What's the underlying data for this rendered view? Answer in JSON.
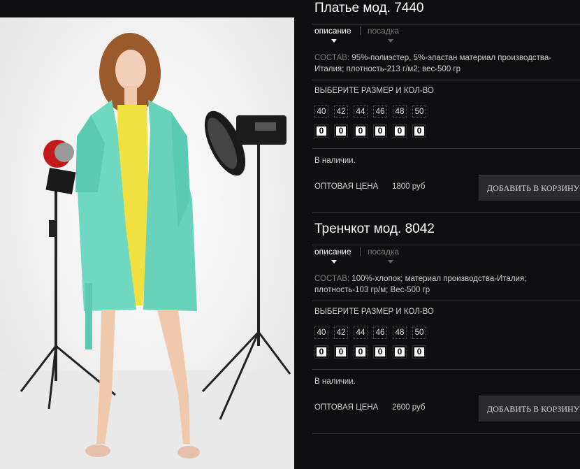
{
  "products": [
    {
      "title": "Платье мод. 7440",
      "tabs": {
        "active": "описание",
        "inactive": "посадка"
      },
      "composition_label": "СОСТАВ:",
      "composition_text": " 95%-полиэстер, 5%-эластан материал производства-Италия; плотность-213 г/м2; вес-500 гр",
      "choose_label": "ВЫБЕРИТЕ РАЗМЕР И КОЛ-ВО",
      "sizes": [
        "40",
        "42",
        "44",
        "46",
        "48",
        "50"
      ],
      "quantities": [
        "0",
        "0",
        "0",
        "0",
        "0",
        "0"
      ],
      "stock": "В наличии.",
      "price_label": "ОПТОВАЯ ЦЕНА",
      "price": "1800 руб",
      "button": "ДОБАВИТЬ В КОРЗИНУ"
    },
    {
      "title": "Тренчкот мод. 8042",
      "tabs": {
        "active": "описание",
        "inactive": "посадка"
      },
      "composition_label": "СОСТАВ:",
      "composition_text": " 100%-хлопок; материал производства-Италия; плотность-103 гр/м; Вес-500 гр",
      "choose_label": "ВЫБЕРИТЕ РАЗМЕР И КОЛ-ВО",
      "sizes": [
        "40",
        "42",
        "44",
        "46",
        "48",
        "50"
      ],
      "quantities": [
        "0",
        "0",
        "0",
        "0",
        "0",
        "0"
      ],
      "stock": "В наличии.",
      "price_label": "ОПТОВАЯ ЦЕНА",
      "price": "2600 руб",
      "button": "ДОБАВИТЬ В КОРЗИНУ"
    }
  ],
  "colors": {
    "background": "#0f0f11",
    "coat": "#6fd8c0",
    "dress": "#f0e040",
    "button_bg": "#2b2b2e"
  }
}
